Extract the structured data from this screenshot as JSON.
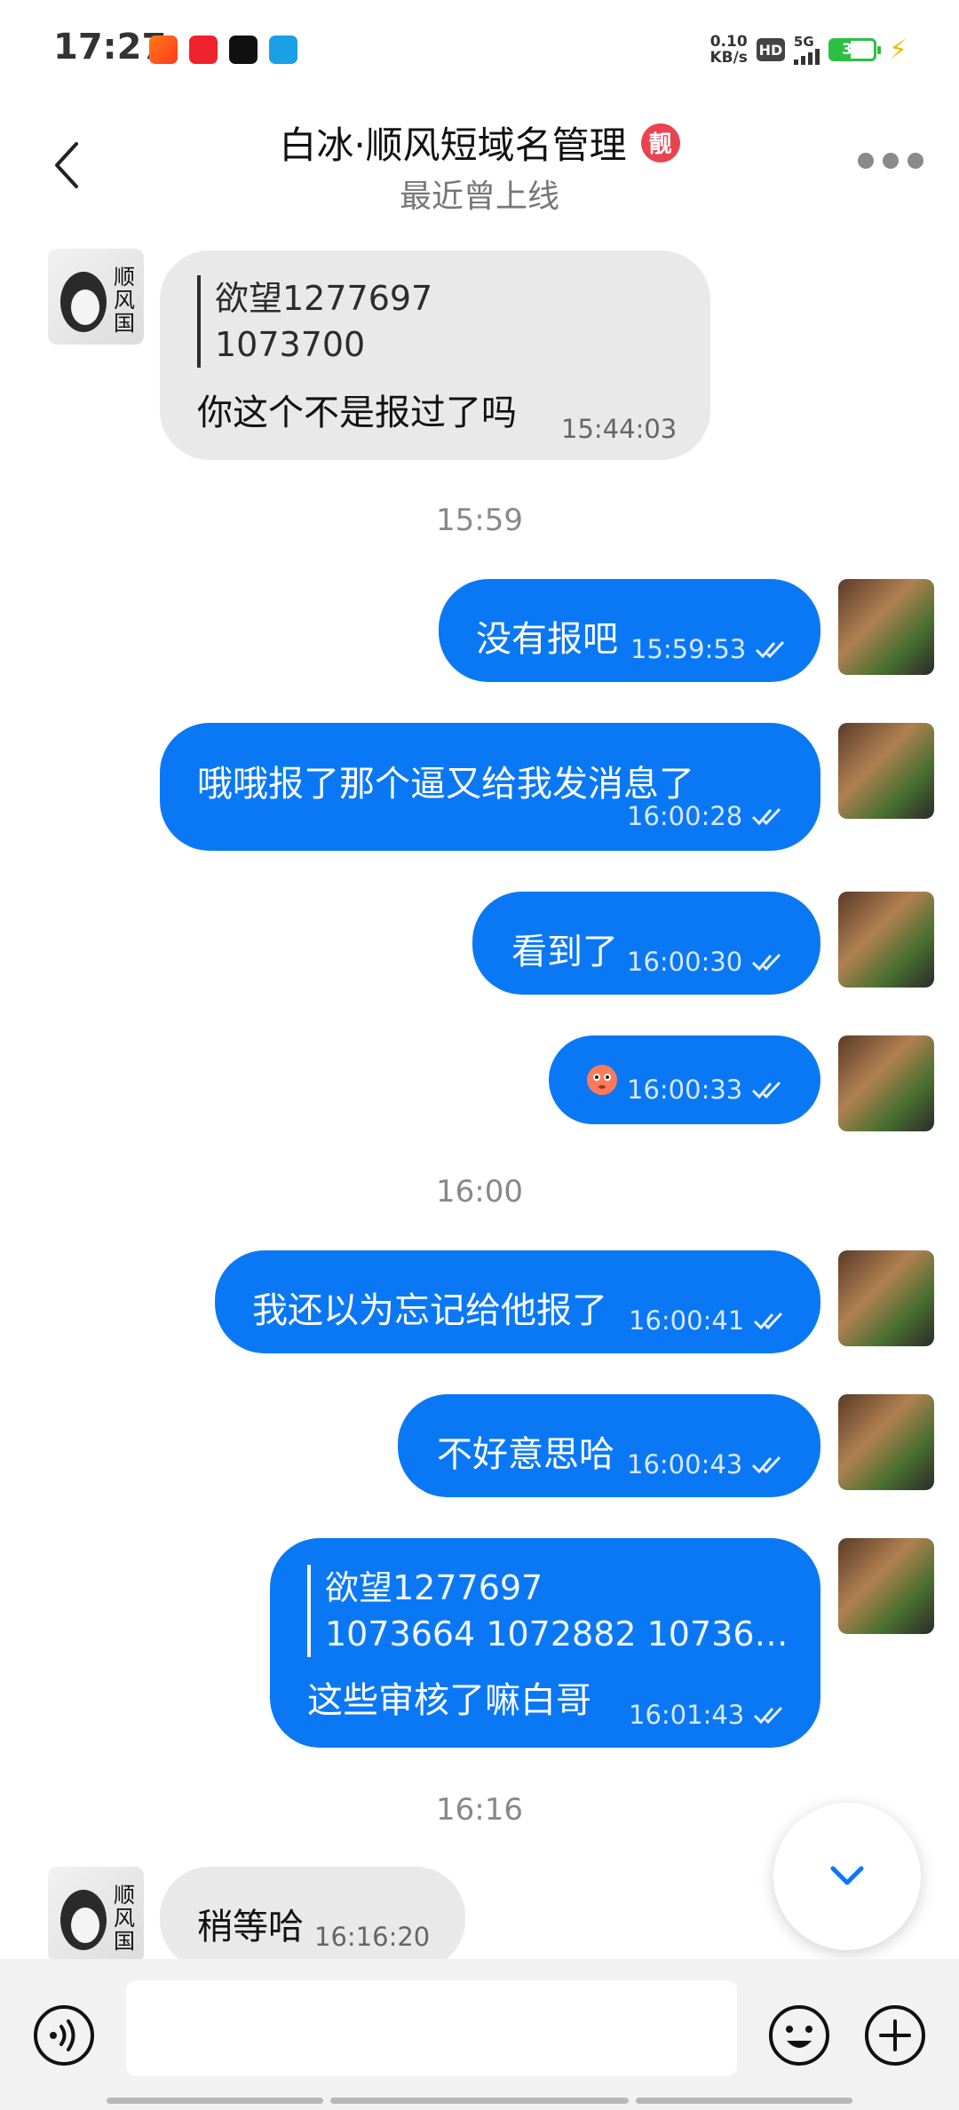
{
  "status_bar": {
    "time": "17:27",
    "net_speed_value": "0.10",
    "net_speed_unit": "KB/s",
    "hd_label": "HD",
    "signal_label": "5G",
    "battery_percent": "33"
  },
  "header": {
    "title": "白冰·顺风短域名管理",
    "badge": "靓",
    "subtitle": "最近曾上线"
  },
  "messages": [
    {
      "side": "in",
      "quote": "欲望1277697\n1073700",
      "text": "你这个不是报过了吗",
      "time": "15:44:03"
    },
    {
      "side": "out",
      "text": "没有报吧",
      "time": "15:59:53"
    },
    {
      "side": "out",
      "text": "哦哦报了那个逼又给我发消息了",
      "time": "16:00:28"
    },
    {
      "side": "out",
      "text": "看到了",
      "time": "16:00:30"
    },
    {
      "side": "out",
      "text": "",
      "emoji": "emoji-face",
      "time": "16:00:33"
    },
    {
      "side": "out",
      "text": "我还以为忘记给他报了",
      "time": "16:00:41"
    },
    {
      "side": "out",
      "text": "不好意思哈",
      "time": "16:00:43"
    },
    {
      "side": "out",
      "quote": "欲望1277697\n1073664 1072882 10736…",
      "text": "这些审核了嘛白哥",
      "time": "16:01:43"
    },
    {
      "side": "in",
      "text": "稍等哈",
      "time": "16:16:20"
    }
  ],
  "separators": [
    "15:59",
    "16:00",
    "16:16"
  ],
  "input": {
    "placeholder": ""
  },
  "colors": {
    "outgoing_bubble": "#0a78f5",
    "incoming_bubble": "#e9e9e9",
    "badge": "#e8434f",
    "battery": "#2dbf44"
  }
}
